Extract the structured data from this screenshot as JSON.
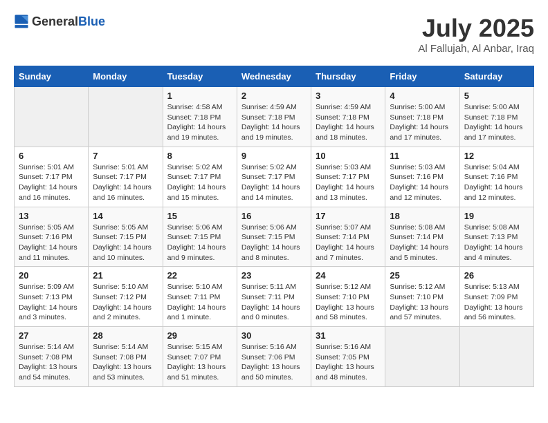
{
  "header": {
    "logo_general": "General",
    "logo_blue": "Blue",
    "title": "July 2025",
    "subtitle": "Al Fallujah, Al Anbar, Iraq"
  },
  "weekdays": [
    "Sunday",
    "Monday",
    "Tuesday",
    "Wednesday",
    "Thursday",
    "Friday",
    "Saturday"
  ],
  "weeks": [
    [
      {
        "day": "",
        "detail": ""
      },
      {
        "day": "",
        "detail": ""
      },
      {
        "day": "1",
        "detail": "Sunrise: 4:58 AM\nSunset: 7:18 PM\nDaylight: 14 hours\nand 19 minutes."
      },
      {
        "day": "2",
        "detail": "Sunrise: 4:59 AM\nSunset: 7:18 PM\nDaylight: 14 hours\nand 19 minutes."
      },
      {
        "day": "3",
        "detail": "Sunrise: 4:59 AM\nSunset: 7:18 PM\nDaylight: 14 hours\nand 18 minutes."
      },
      {
        "day": "4",
        "detail": "Sunrise: 5:00 AM\nSunset: 7:18 PM\nDaylight: 14 hours\nand 17 minutes."
      },
      {
        "day": "5",
        "detail": "Sunrise: 5:00 AM\nSunset: 7:18 PM\nDaylight: 14 hours\nand 17 minutes."
      }
    ],
    [
      {
        "day": "6",
        "detail": "Sunrise: 5:01 AM\nSunset: 7:17 PM\nDaylight: 14 hours\nand 16 minutes."
      },
      {
        "day": "7",
        "detail": "Sunrise: 5:01 AM\nSunset: 7:17 PM\nDaylight: 14 hours\nand 16 minutes."
      },
      {
        "day": "8",
        "detail": "Sunrise: 5:02 AM\nSunset: 7:17 PM\nDaylight: 14 hours\nand 15 minutes."
      },
      {
        "day": "9",
        "detail": "Sunrise: 5:02 AM\nSunset: 7:17 PM\nDaylight: 14 hours\nand 14 minutes."
      },
      {
        "day": "10",
        "detail": "Sunrise: 5:03 AM\nSunset: 7:17 PM\nDaylight: 14 hours\nand 13 minutes."
      },
      {
        "day": "11",
        "detail": "Sunrise: 5:03 AM\nSunset: 7:16 PM\nDaylight: 14 hours\nand 12 minutes."
      },
      {
        "day": "12",
        "detail": "Sunrise: 5:04 AM\nSunset: 7:16 PM\nDaylight: 14 hours\nand 12 minutes."
      }
    ],
    [
      {
        "day": "13",
        "detail": "Sunrise: 5:05 AM\nSunset: 7:16 PM\nDaylight: 14 hours\nand 11 minutes."
      },
      {
        "day": "14",
        "detail": "Sunrise: 5:05 AM\nSunset: 7:15 PM\nDaylight: 14 hours\nand 10 minutes."
      },
      {
        "day": "15",
        "detail": "Sunrise: 5:06 AM\nSunset: 7:15 PM\nDaylight: 14 hours\nand 9 minutes."
      },
      {
        "day": "16",
        "detail": "Sunrise: 5:06 AM\nSunset: 7:15 PM\nDaylight: 14 hours\nand 8 minutes."
      },
      {
        "day": "17",
        "detail": "Sunrise: 5:07 AM\nSunset: 7:14 PM\nDaylight: 14 hours\nand 7 minutes."
      },
      {
        "day": "18",
        "detail": "Sunrise: 5:08 AM\nSunset: 7:14 PM\nDaylight: 14 hours\nand 5 minutes."
      },
      {
        "day": "19",
        "detail": "Sunrise: 5:08 AM\nSunset: 7:13 PM\nDaylight: 14 hours\nand 4 minutes."
      }
    ],
    [
      {
        "day": "20",
        "detail": "Sunrise: 5:09 AM\nSunset: 7:13 PM\nDaylight: 14 hours\nand 3 minutes."
      },
      {
        "day": "21",
        "detail": "Sunrise: 5:10 AM\nSunset: 7:12 PM\nDaylight: 14 hours\nand 2 minutes."
      },
      {
        "day": "22",
        "detail": "Sunrise: 5:10 AM\nSunset: 7:11 PM\nDaylight: 14 hours\nand 1 minute."
      },
      {
        "day": "23",
        "detail": "Sunrise: 5:11 AM\nSunset: 7:11 PM\nDaylight: 14 hours\nand 0 minutes."
      },
      {
        "day": "24",
        "detail": "Sunrise: 5:12 AM\nSunset: 7:10 PM\nDaylight: 13 hours\nand 58 minutes."
      },
      {
        "day": "25",
        "detail": "Sunrise: 5:12 AM\nSunset: 7:10 PM\nDaylight: 13 hours\nand 57 minutes."
      },
      {
        "day": "26",
        "detail": "Sunrise: 5:13 AM\nSunset: 7:09 PM\nDaylight: 13 hours\nand 56 minutes."
      }
    ],
    [
      {
        "day": "27",
        "detail": "Sunrise: 5:14 AM\nSunset: 7:08 PM\nDaylight: 13 hours\nand 54 minutes."
      },
      {
        "day": "28",
        "detail": "Sunrise: 5:14 AM\nSunset: 7:08 PM\nDaylight: 13 hours\nand 53 minutes."
      },
      {
        "day": "29",
        "detail": "Sunrise: 5:15 AM\nSunset: 7:07 PM\nDaylight: 13 hours\nand 51 minutes."
      },
      {
        "day": "30",
        "detail": "Sunrise: 5:16 AM\nSunset: 7:06 PM\nDaylight: 13 hours\nand 50 minutes."
      },
      {
        "day": "31",
        "detail": "Sunrise: 5:16 AM\nSunset: 7:05 PM\nDaylight: 13 hours\nand 48 minutes."
      },
      {
        "day": "",
        "detail": ""
      },
      {
        "day": "",
        "detail": ""
      }
    ]
  ]
}
